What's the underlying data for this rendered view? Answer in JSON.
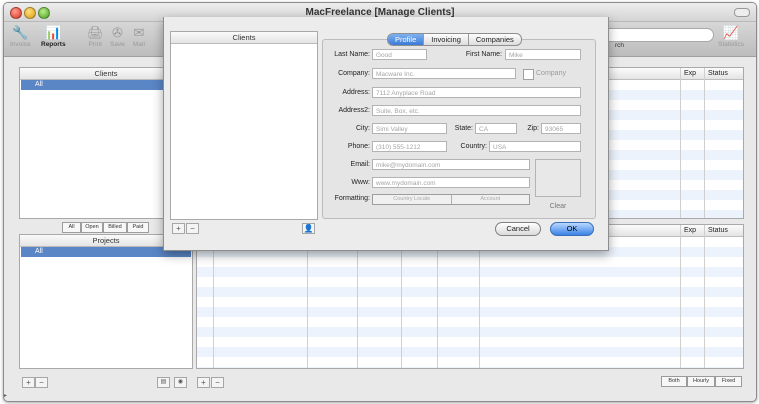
{
  "window": {
    "title": "MacFreelance [Manage Clients]"
  },
  "toolbar": {
    "items": [
      "Invoice",
      "Reports",
      "Print",
      "Save",
      "Mail"
    ],
    "search_label": "rch",
    "statistics_label": "Statistics"
  },
  "clients_panel": {
    "header": "Clients",
    "selected": "All"
  },
  "filter_buttons": [
    "All",
    "Open",
    "Billed",
    "Paid"
  ],
  "projects_panel": {
    "header": "Projects",
    "selected": "All"
  },
  "top_table": {
    "columns": [
      "Exp",
      "Status"
    ]
  },
  "bottom_table": {
    "columns": [
      "Exp",
      "Status"
    ]
  },
  "rate_buttons": [
    "Both",
    "Hourly",
    "Fixed"
  ],
  "sheet": {
    "list_header": "Clients",
    "tabs": [
      "Profile",
      "Invoicing",
      "Companies"
    ],
    "active_tab": "Profile",
    "fields": {
      "last_name": {
        "label": "Last Name:",
        "placeholder": "Good"
      },
      "first_name": {
        "label": "First Name:",
        "placeholder": "Mike"
      },
      "company": {
        "label": "Company:",
        "placeholder": "Macware Inc."
      },
      "company_checkbox": "Company",
      "address": {
        "label": "Address:",
        "placeholder": "7112 Anyplace Road"
      },
      "address2": {
        "label": "Address2:",
        "placeholder": "Suite, Box, etc."
      },
      "city": {
        "label": "City:",
        "placeholder": "Simi Valley"
      },
      "state": {
        "label": "State:",
        "placeholder": "CA"
      },
      "zip": {
        "label": "Zip:",
        "placeholder": "93065"
      },
      "phone": {
        "label": "Phone:",
        "placeholder": "(310) 555-1212"
      },
      "country": {
        "label": "Country:",
        "placeholder": "USA"
      },
      "email": {
        "label": "Email:",
        "placeholder": "mike@mydomain.com"
      },
      "www": {
        "label": "Www:",
        "placeholder": "www.mydomain.com"
      },
      "formatting": {
        "label": "Formatting:",
        "options": [
          "Country Locale",
          "Account"
        ]
      }
    },
    "clear_label": "Clear",
    "cancel_label": "Cancel",
    "ok_label": "OK"
  }
}
